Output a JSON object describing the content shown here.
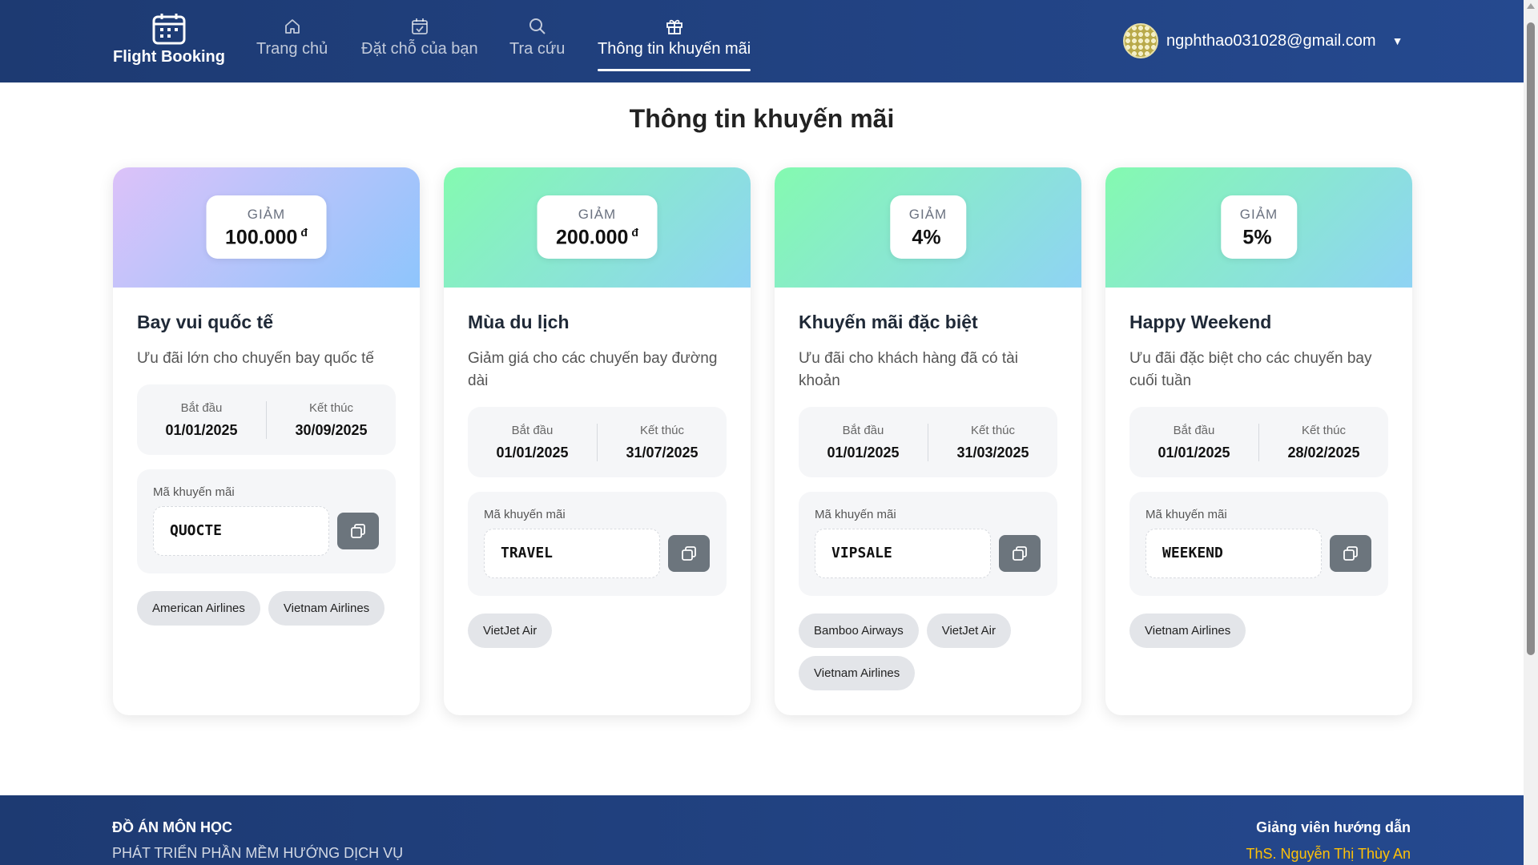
{
  "header": {
    "brand": "Flight Booking",
    "nav": [
      {
        "label": "Trang chủ",
        "icon": "home-icon"
      },
      {
        "label": "Đặt chỗ của bạn",
        "icon": "calendar-check-icon"
      },
      {
        "label": "Tra cứu",
        "icon": "search-icon"
      },
      {
        "label": "Thông tin khuyến mãi",
        "icon": "gift-icon",
        "active": true
      }
    ],
    "user_email": "ngphthao031028@gmail.com"
  },
  "page_title": "Thông tin khuyến mãi",
  "labels": {
    "discount": "GIẢM",
    "start": "Bắt đầu",
    "end": "Kết thúc",
    "code": "Mã khuyến mãi",
    "currency": "đ"
  },
  "promotions": [
    {
      "discount": "100.000",
      "currency": "đ",
      "title": "Bay vui quốc tế",
      "description": "Ưu đãi lớn cho chuyến bay quốc tế",
      "start": "01/01/2025",
      "end": "30/09/2025",
      "code": "QUOCTE",
      "airlines": [
        "American Airlines",
        "Vietnam Airlines"
      ],
      "gradient": [
        "#dcc2f9",
        "#8ec5fc"
      ]
    },
    {
      "discount": "200.000",
      "currency": "đ",
      "title": "Mùa du lịch",
      "description": "Giảm giá cho các chuyến bay đường dài",
      "start": "01/01/2025",
      "end": "31/07/2025",
      "code": "TRAVEL",
      "airlines": [
        "VietJet Air"
      ],
      "gradient": [
        "#84fab0",
        "#8fd3f4"
      ]
    },
    {
      "discount": "4%",
      "currency": "",
      "title": "Khuyến mãi đặc biệt",
      "description": "Ưu đãi cho khách hàng đã có tài khoản",
      "start": "01/01/2025",
      "end": "31/03/2025",
      "code": "VIPSALE",
      "airlines": [
        "Bamboo Airways",
        "VietJet Air",
        "Vietnam Airlines"
      ],
      "gradient": [
        "#84fab0",
        "#8fd3f4"
      ]
    },
    {
      "discount": "5%",
      "currency": "",
      "title": "Happy Weekend",
      "description": "Ưu đãi đặc biệt cho các chuyến bay cuối tuần",
      "start": "01/01/2025",
      "end": "28/02/2025",
      "code": "WEEKEND",
      "airlines": [
        "Vietnam Airlines"
      ],
      "gradient": [
        "#84fab0",
        "#8fd3f4"
      ]
    }
  ],
  "footer": {
    "title": "ĐỒ ÁN MÔN HỌC",
    "subtitle": "PHÁT TRIỂN PHẦN MỀM HƯỚNG DỊCH VỤ",
    "advisor_label": "Giảng viên hướng dẫn",
    "advisor_name": "ThS. Nguyễn Thị Thùy An"
  },
  "colors": {
    "header_bg": "#1d3a72",
    "advisor_name": "#ffc107",
    "copy_button": "#6c757d"
  }
}
